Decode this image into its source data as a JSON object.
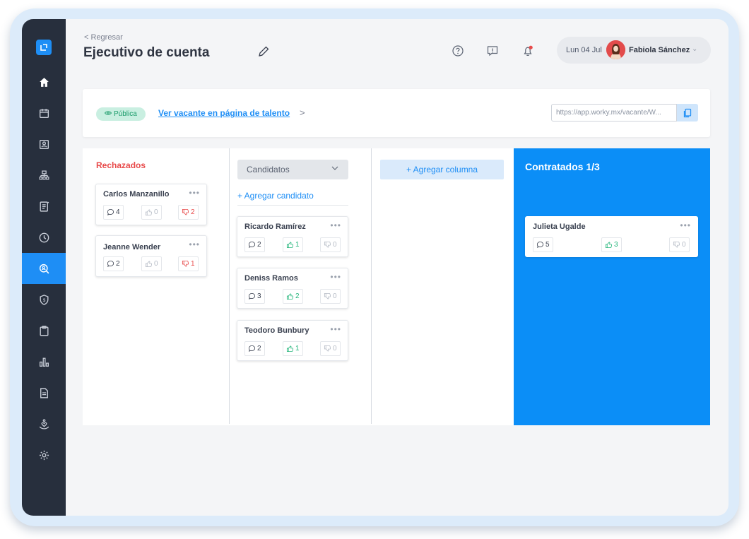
{
  "header": {
    "back_label": "Regresar",
    "title": "Ejecutivo de cuenta",
    "date": "Lun 04 Jul",
    "user_name": "Fabiola Sánchez"
  },
  "vacancy": {
    "badge": "Pública",
    "talent_link": "Ver vacante en página de talento",
    "url": "https://app.worky.mx/vacante/W..."
  },
  "columns": {
    "rejected": {
      "title": "Rechazados",
      "cards": [
        {
          "name": "Carlos Manzanillo",
          "comments": "4",
          "likes": "0",
          "dislikes": "2"
        },
        {
          "name": "Jeanne Wender",
          "comments": "2",
          "likes": "0",
          "dislikes": "1"
        }
      ]
    },
    "candidates": {
      "stage": "Candidatos",
      "add_label": "+ Agregar candidato",
      "cards": [
        {
          "name": "Ricardo Ramírez",
          "comments": "2",
          "likes": "1",
          "dislikes": "0"
        },
        {
          "name": "Deniss Ramos",
          "comments": "3",
          "likes": "2",
          "dislikes": "0"
        },
        {
          "name": "Teodoro Bunbury",
          "comments": "2",
          "likes": "1",
          "dislikes": "0"
        }
      ]
    },
    "add_column_label": "+ Agregar columna",
    "hired": {
      "title": "Contratados 1/3",
      "cards": [
        {
          "name": "Julieta Ugalde",
          "comments": "5",
          "likes": "3",
          "dislikes": "0"
        }
      ]
    }
  },
  "icons": {
    "sidebar": [
      "logo-icon",
      "home-icon",
      "calendar-icon",
      "id-card-icon",
      "org-chart-icon",
      "document-icon",
      "clock-icon",
      "search-person-icon",
      "shield-money-icon",
      "clipboard-icon",
      "bar-chart-icon",
      "file-icon",
      "hand-heart-icon",
      "settings-icon"
    ],
    "header": [
      "help-icon",
      "feedback-icon",
      "notification-bell-icon"
    ]
  },
  "colors": {
    "sidebar": "#272f3d",
    "accent": "#1e8ef5",
    "rejected": "#e84a4a",
    "positive": "#26b67c",
    "hired_column": "#0b8ef7"
  },
  "dots": "•••",
  "talent_chevron": ">",
  "back_chevron": "<"
}
